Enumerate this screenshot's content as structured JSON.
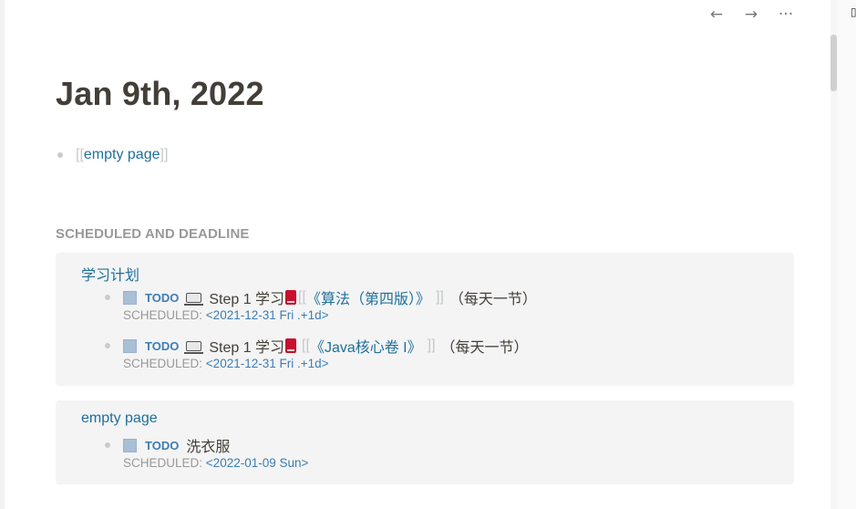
{
  "toolbar": {
    "back_icon": "←",
    "forward_icon": "→",
    "more_icon": "···"
  },
  "page": {
    "title": "Jan 9th, 2022",
    "block": {
      "open_bracket": "[[",
      "link": "empty page",
      "close_bracket": "]]"
    }
  },
  "section": {
    "title": "SCHEDULED AND DEADLINE"
  },
  "groups": [
    {
      "title": "学习计划",
      "items": [
        {
          "marker": "TODO",
          "text": "Step 1 学习",
          "open_bracket": "[[",
          "link": "《算法（第四版）》",
          "close_bracket": "]]",
          "suffix": "（每天一节）",
          "scheduled_label": "SCHEDULED:",
          "scheduled_date": "<2021-12-31 Fri .+1d>"
        },
        {
          "marker": "TODO",
          "text": "Step 1 学习",
          "open_bracket": "[[",
          "link": "《Java核心卷 I》",
          "close_bracket": "]]",
          "suffix": "（每天一节）",
          "scheduled_label": "SCHEDULED:",
          "scheduled_date": "<2021-12-31 Fri .+1d>"
        }
      ]
    },
    {
      "title": "empty page",
      "items": [
        {
          "marker": "TODO",
          "text": "洗衣服",
          "scheduled_label": "SCHEDULED:",
          "scheduled_date": "<2022-01-09 Sun>"
        }
      ]
    }
  ],
  "colors": {
    "link": "#1f6f9a",
    "marker": "#3d7db3",
    "checkbox": "#a8bfd6",
    "book": "#c8102e",
    "muted": "#999999"
  },
  "icons": [
    "arrow-left-icon",
    "arrow-right-icon",
    "more-icon",
    "laptop-icon",
    "red-book-icon",
    "bullet-icon"
  ]
}
